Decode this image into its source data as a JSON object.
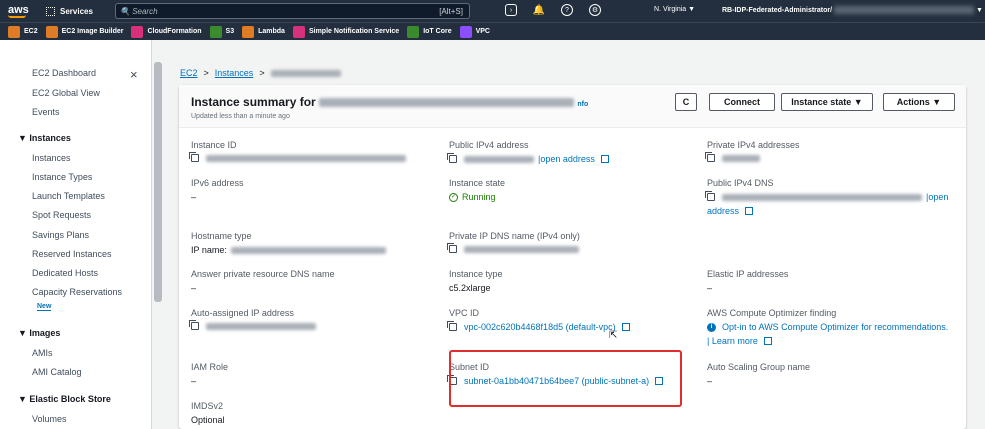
{
  "topnav": {
    "logo": "aws",
    "services": "Services",
    "search_placeholder": "Search",
    "shortcut": "[Alt+S]",
    "region": "N. Virginia ▼",
    "account": "RB-IDP-Federated-Administrator/",
    "account_caret": "▼"
  },
  "favorites": [
    {
      "label": "EC2",
      "color": "#e07b26"
    },
    {
      "label": "EC2 Image Builder",
      "color": "#e07b26"
    },
    {
      "label": "CloudFormation",
      "color": "#d6317a"
    },
    {
      "label": "S3",
      "color": "#3b8b2c"
    },
    {
      "label": "Lambda",
      "color": "#e07b26"
    },
    {
      "label": "Simple Notification Service",
      "color": "#d6317a"
    },
    {
      "label": "IoT Core",
      "color": "#3b8b2c"
    },
    {
      "label": "VPC",
      "color": "#8c4fff"
    }
  ],
  "sidebar": {
    "close": "×",
    "new_badge": "New",
    "items": [
      "EC2 Dashboard",
      "EC2 Global View",
      "Events",
      "Instances",
      "Instance Types",
      "Launch Templates",
      "Spot Requests",
      "Savings Plans",
      "Reserved Instances",
      "Dedicated Hosts",
      "Capacity Reservations",
      "AMIs",
      "AMI Catalog",
      "Volumes"
    ],
    "sections": [
      "▼ Instances",
      "▼ Images",
      "▼ Elastic Block Store"
    ]
  },
  "breadcrumb": {
    "ec2": "EC2",
    "instances": "Instances",
    "sep": ">"
  },
  "summary": {
    "title": "Instance summary for",
    "info": "nfo",
    "updated": "Updated less than a minute ago",
    "refresh": "C",
    "connect": "Connect",
    "state_btn": "Instance state ▼",
    "actions_btn": "Actions ▼"
  },
  "fields": {
    "instance_id": "Instance ID",
    "ipv6": "IPv6 address",
    "ipv6_val": "–",
    "hostname": "Hostname type",
    "ip_name": "IP name:",
    "answer_dns": "Answer private resource DNS name",
    "answer_dns_val": "–",
    "auto_ip": "Auto-assigned IP address",
    "iam": "IAM Role",
    "iam_val": "–",
    "imds": "IMDSv2",
    "imds_val": "Optional",
    "pub_ipv4": "Public IPv4 address",
    "open_address": "open address",
    "state": "Instance state",
    "state_val": "Running",
    "priv_dns": "Private IP DNS name (IPv4 only)",
    "type": "Instance type",
    "type_val": "c5.2xlarge",
    "vpc": "VPC ID",
    "vpc_val": "vpc-002c620b4468f18d5 (default-vpc)",
    "subnet": "Subnet ID",
    "subnet_val": "subnet-0a1bb40471b64bee7 (public-subnet-a)",
    "priv_ipv4": "Private IPv4 addresses",
    "pub_dns": "Public IPv4 DNS",
    "open": "open",
    "address": "address",
    "eip": "Elastic IP addresses",
    "eip_val": "–",
    "optimizer": "AWS Compute Optimizer finding",
    "optimizer_link": "Opt-in to AWS Compute Optimizer for recommendations.",
    "learn_more": "| Learn more",
    "asg": "Auto Scaling Group name",
    "asg_val": "–"
  }
}
